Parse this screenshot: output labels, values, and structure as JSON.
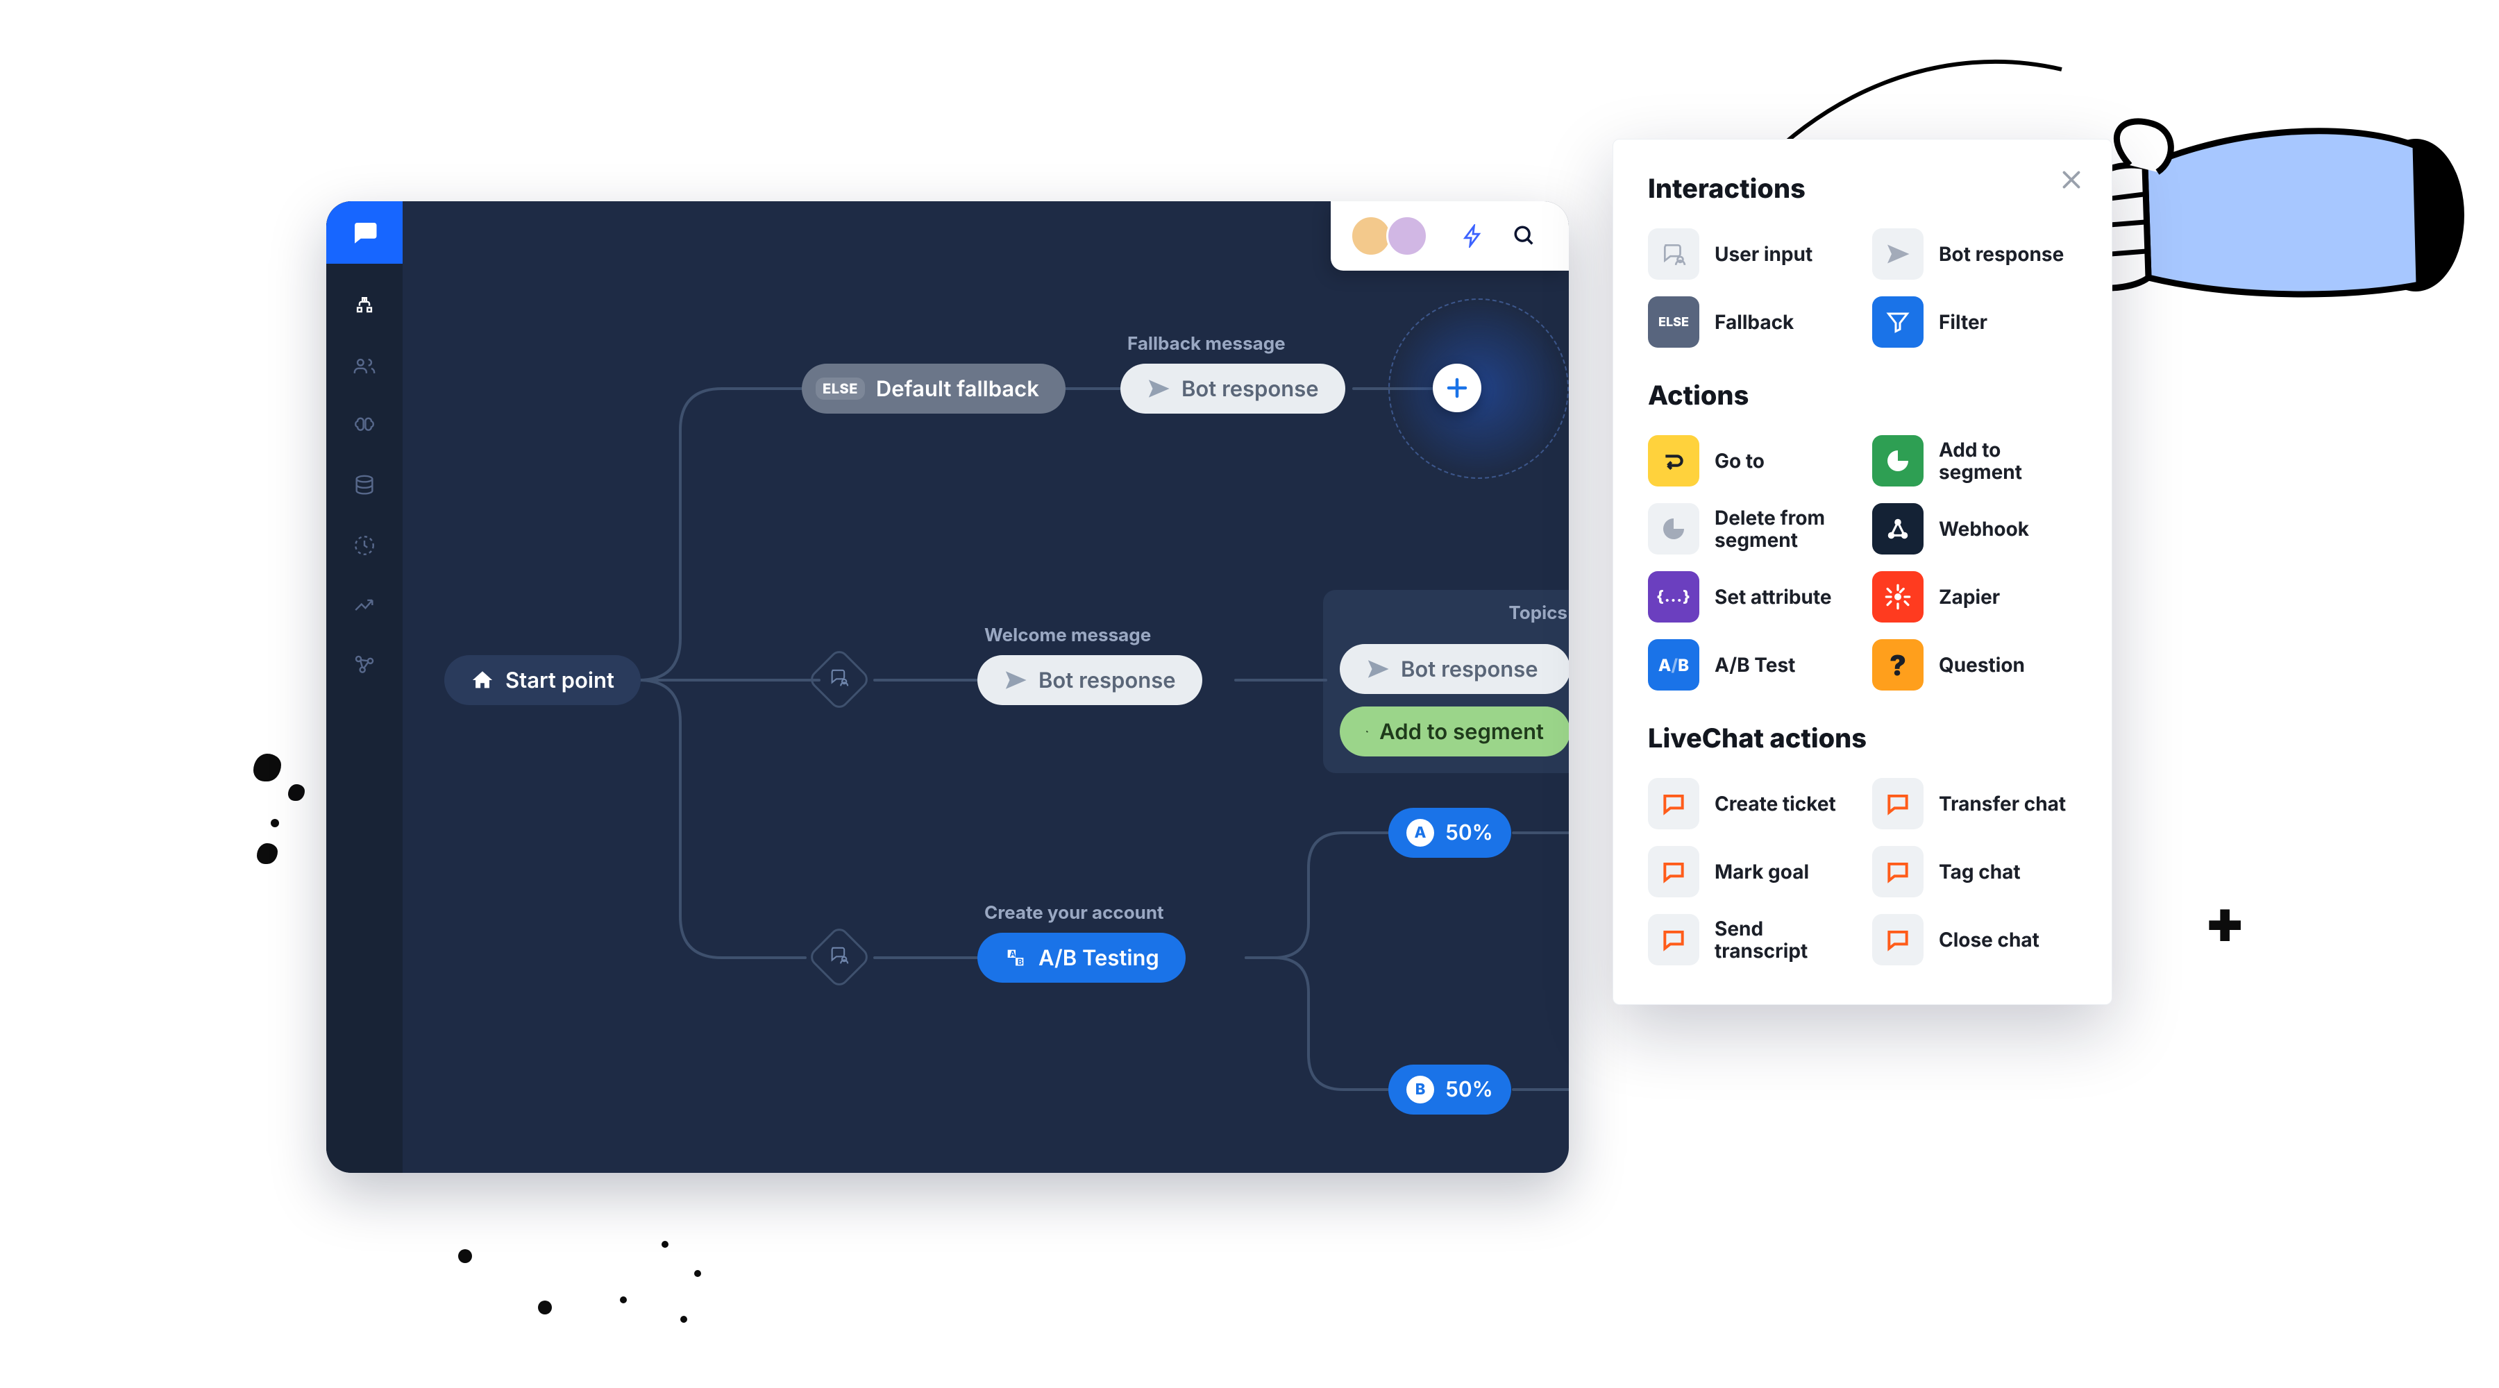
{
  "sidebar": {
    "brand_icon": "chat-icon",
    "items": [
      "tree-icon",
      "users-icon",
      "brain-icon",
      "database-icon",
      "clock-icon",
      "trend-icon",
      "nodes-icon"
    ]
  },
  "topbar": {
    "avatars": [
      "avatar-1",
      "avatar-2"
    ],
    "lightning": "lightning-icon",
    "search": "search-icon"
  },
  "flow": {
    "start": "Start point",
    "fallback_label": "Fallback message",
    "fallback_node": "Default fallback",
    "fallback_else": "ELSE",
    "fallback_bot": "Bot response",
    "welcome_label": "Welcome message",
    "welcome_bot": "Bot response",
    "topics_label": "Topics",
    "topics_bot": "Bot response",
    "topics_segment": "Add to segment",
    "ab_label": "Create your account",
    "ab_node": "A/B Testing",
    "branch_a": "50%",
    "branch_a_letter": "A",
    "branch_b": "50%",
    "branch_b_letter": "B",
    "add_button": "+"
  },
  "panel": {
    "sections": [
      {
        "title": "Interactions",
        "items": [
          {
            "label": "User input",
            "icon": "user-input-icon",
            "style": "grey-lt"
          },
          {
            "label": "Bot response",
            "icon": "send-icon",
            "style": "grey-lt"
          },
          {
            "label": "Fallback",
            "icon": "else-icon",
            "style": "dark"
          },
          {
            "label": "Filter",
            "icon": "filter-icon",
            "style": "blue"
          }
        ]
      },
      {
        "title": "Actions",
        "items": [
          {
            "label": "Go to",
            "icon": "goto-icon",
            "style": "yellow"
          },
          {
            "label": "Add to segment",
            "icon": "segment-icon",
            "style": "green"
          },
          {
            "label": "Delete from segment",
            "icon": "segment-icon",
            "style": "grey-lt"
          },
          {
            "label": "Webhook",
            "icon": "webhook-icon",
            "style": "dk"
          },
          {
            "label": "Set attribute",
            "icon": "attr-icon",
            "style": "purple"
          },
          {
            "label": "Zapier",
            "icon": "zapier-icon",
            "style": "zap"
          },
          {
            "label": "A/B Test",
            "icon": "ab-icon",
            "style": "blue"
          },
          {
            "label": "Question",
            "icon": "question-icon",
            "style": "q"
          }
        ]
      },
      {
        "title": "LiveChat actions",
        "items": [
          {
            "label": "Create ticket",
            "icon": "lc-icon",
            "style": "lc"
          },
          {
            "label": "Transfer chat",
            "icon": "lc-icon",
            "style": "lc"
          },
          {
            "label": "Mark goal",
            "icon": "lc-icon",
            "style": "lc"
          },
          {
            "label": "Tag chat",
            "icon": "lc-icon",
            "style": "lc"
          },
          {
            "label": "Send transcript",
            "icon": "lc-icon",
            "style": "lc"
          },
          {
            "label": "Close chat",
            "icon": "lc-icon",
            "style": "lc"
          }
        ]
      }
    ],
    "close": "×"
  }
}
